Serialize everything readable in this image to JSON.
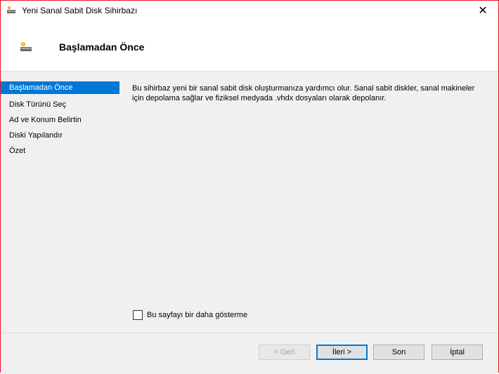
{
  "window": {
    "title": "Yeni Sanal Sabit Disk Sihirbazı",
    "close_glyph": "✕"
  },
  "header": {
    "title": "Başlamadan Önce"
  },
  "steps": [
    {
      "label": "Başlamadan Önce",
      "active": true
    },
    {
      "label": "Disk Türünü Seç"
    },
    {
      "label": "Ad ve Konum Belirtin"
    },
    {
      "label": "Diski Yapılandır"
    },
    {
      "label": "Özet"
    }
  ],
  "content": {
    "description": "Bu sihirbaz yeni bir sanal sabit disk oluşturmanıza yardımcı olur. Sanal sabit diskler, sanal makineler için depolama sağlar ve fiziksel medyada .vhdx dosyaları olarak depolanır.",
    "checkbox_label": "Bu sayfayı bir daha gösterme",
    "checkbox_checked": false
  },
  "buttons": {
    "back": "< Geri",
    "next": "İleri >",
    "finish": "Son",
    "cancel": "İptal"
  },
  "colors": {
    "accent": "#0078d7",
    "window_border": "#e81123"
  }
}
